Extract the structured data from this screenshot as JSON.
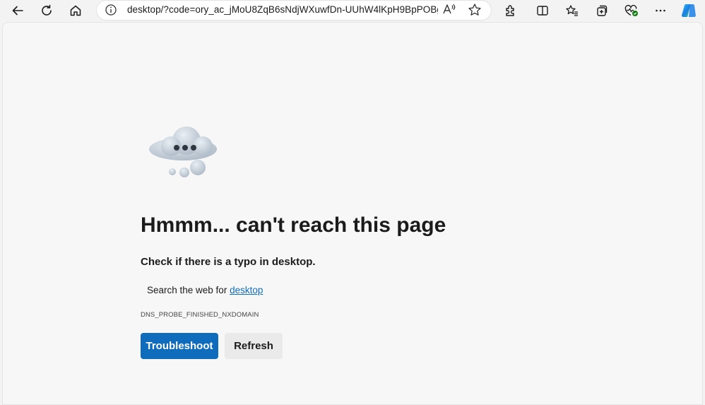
{
  "toolbar": {
    "url": "desktop/?code=ory_ac_jMoU8ZqB6sNdjWXuwfDn-UUhW4lKpH9BpPOBg...",
    "read_aloud": "Aͅ",
    "icons": [
      "back-icon",
      "refresh-icon",
      "home-icon",
      "info-icon",
      "read-aloud-icon",
      "favorite-star-icon",
      "extensions-icon",
      "split-screen-icon",
      "favorites-icon",
      "collections-icon",
      "browser-essentials-icon",
      "more-icon",
      "copilot-icon"
    ]
  },
  "error": {
    "heading": "Hmmm... can't reach this page",
    "subheading": "Check if there is a typo in desktop.",
    "search_prefix": "Search the web for ",
    "search_link": "desktop",
    "code": "DNS_PROBE_FINISHED_NXDOMAIN",
    "primary_button": "Troubleshoot",
    "secondary_button": "Refresh"
  },
  "colors": {
    "accent": "#0f6cbd",
    "background": "#f7f7f7"
  }
}
